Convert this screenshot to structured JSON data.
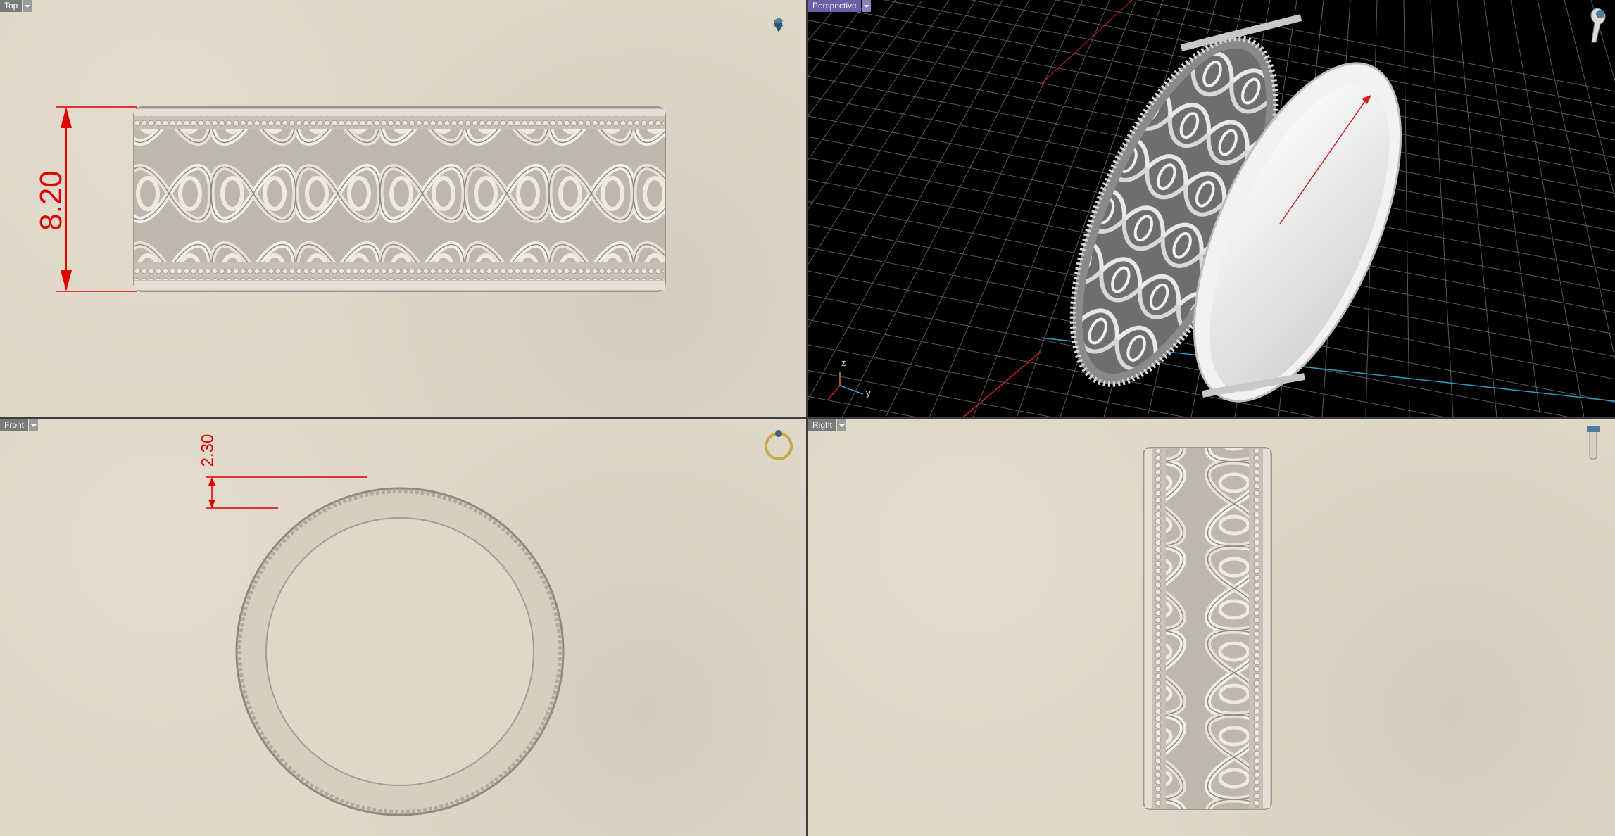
{
  "viewports": {
    "top": {
      "label": "Top"
    },
    "perspective": {
      "label": "Perspective"
    },
    "front": {
      "label": "Front"
    },
    "right": {
      "label": "Right"
    }
  },
  "dimensions": {
    "ring_width": "8.20",
    "band_thickness": "2.30"
  },
  "axis_labels": {
    "z": "z",
    "y": "y"
  },
  "icons": {
    "top_view_icon": "ring-gem-top-icon",
    "perspective_view_icon": "ring-side-icon",
    "front_view_icon": "ring-front-icon",
    "right_view_icon": "ring-right-icon"
  },
  "colors": {
    "viewport_bg": "#dfd8c9",
    "perspective_bg": "#000000",
    "dimension": "#e00000",
    "active_label": "#6b5fa8"
  }
}
